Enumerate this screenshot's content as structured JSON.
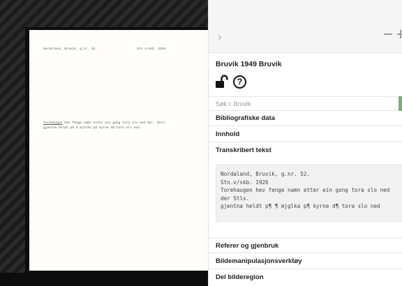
{
  "document_page": {
    "header_left": "Nordaland, Bruvik, g.nr. 52.",
    "header_right": "Stn.v/skb. 1926",
    "line1_underlined": "Torehaugen",
    "line1_rest": " hev fenge namn etter ein gong tora slo ned der. Stsl-",
    "line2": "gjentna heldt på å mjelke på kyrne då tora slo ned."
  },
  "toolbar": {
    "nav_icon": "chevron-right-icon",
    "chevron_glyph": "›",
    "zoom_out_icon": "minus-icon",
    "zoom_in_icon": "plus-icon"
  },
  "record": {
    "title": "Bruvik 1949 Bruvik",
    "lock_icon": "unlocked-padlock-icon",
    "help_icon": "question-circle-icon",
    "help_glyph": "?"
  },
  "search": {
    "placeholder": "Søk i: Bruvik",
    "value": "",
    "accent_color": "#76b36f"
  },
  "sections": {
    "bibliographic": "Bibliografiske data",
    "content": "Innhold",
    "transcribed": "Transkribert tekst",
    "cite": "Referer og gjenbruk",
    "image_tools": "Bildemanipulasjonsverktøy",
    "share_region": "Del bilderegion"
  },
  "transcription": {
    "text": "Nordaland, Bruvik, g.nr. 52.\nStn.v/skb. 1926\nTorehaugen hev fenge namn etter ein gong tora slo ned\nder Stls.\ngjentna heldt p¶ ¶ mjglka p¶ kyrne d¶ tora slo ned"
  }
}
